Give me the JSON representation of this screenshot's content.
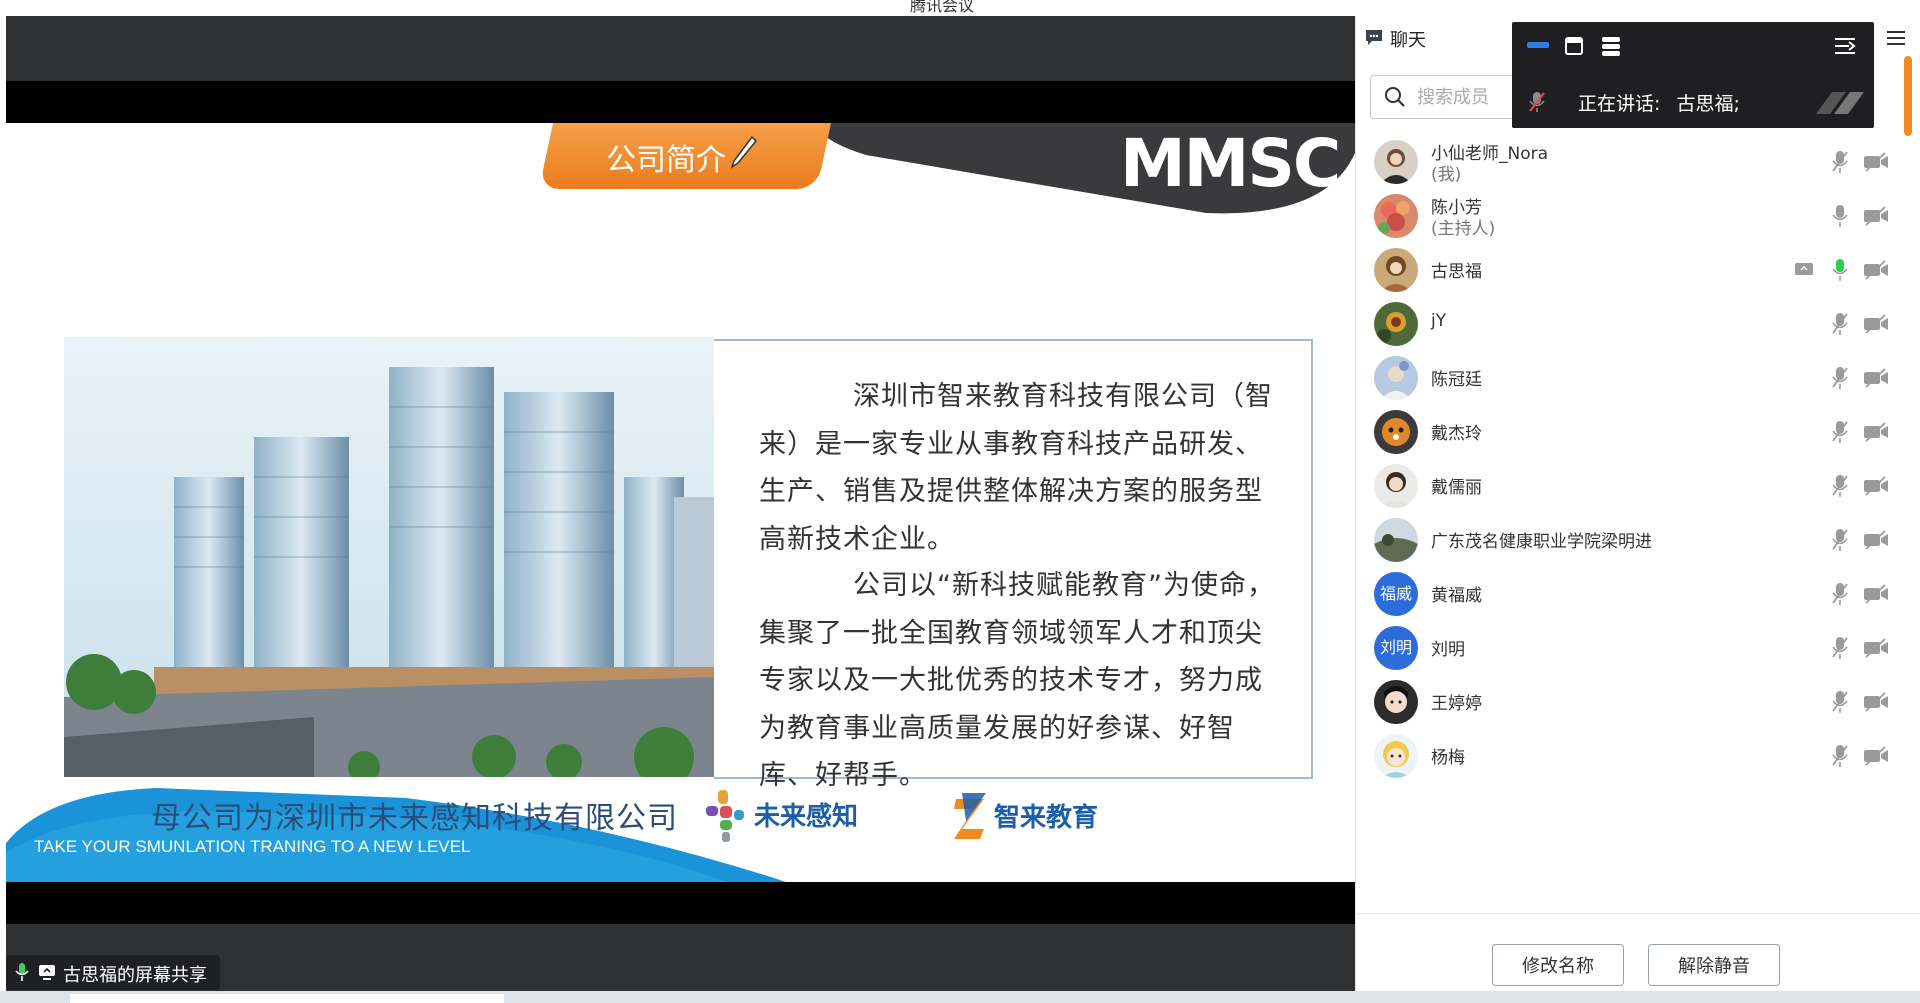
{
  "window": {
    "title": "腾讯会议"
  },
  "share": {
    "label": "古思福的屏幕共享"
  },
  "slide": {
    "tag": "公司简介",
    "brand": "MMSC",
    "para1": "深圳市智来教育科技有限公司（智来）是一家专业从事教育科技产品研发、生产、销售及提供整体解决方案的服务型高新技术企业。",
    "para2": "公司以“新科技赋能教育”为使命，集聚了一批全国教育领域领军人才和顶尖专家以及一大批优秀的技术专才，努力成为教育事业高质量发展的好参谋、好智库、好帮手。",
    "parent_company": "母公司为深圳市未来感知科技有限公司",
    "tagline": "TAKE YOUR SMUNLATION TRANING TO A NEW LEVEL",
    "logo1_name": "未来感知",
    "logo2_name": "智来教育"
  },
  "panel": {
    "chat_tab": "聊天",
    "search_placeholder": "搜索成员",
    "speaking_label": "正在讲话:",
    "speaking_name": "古思福;",
    "members": [
      {
        "name": "小仙老师_Nora",
        "role": "(我)",
        "mic": "muted",
        "avatar_text": ""
      },
      {
        "name": "陈小芳",
        "role": "(主持人)",
        "mic": "off",
        "avatar_text": ""
      },
      {
        "name": "古思福",
        "role": "",
        "mic": "speaking",
        "sharing": true,
        "avatar_text": ""
      },
      {
        "name": "jY",
        "role": "",
        "mic": "muted",
        "avatar_text": ""
      },
      {
        "name": "陈冠廷",
        "role": "",
        "mic": "muted",
        "avatar_text": ""
      },
      {
        "name": "戴杰玲",
        "role": "",
        "mic": "muted",
        "avatar_text": ""
      },
      {
        "name": "戴儒丽",
        "role": "",
        "mic": "muted",
        "avatar_text": ""
      },
      {
        "name": "广东茂名健康职业学院梁明进",
        "role": "",
        "mic": "muted",
        "avatar_text": ""
      },
      {
        "name": "黄福威",
        "role": "",
        "mic": "muted",
        "avatar_text": "福威"
      },
      {
        "name": "刘明",
        "role": "",
        "mic": "muted",
        "avatar_text": "刘明"
      },
      {
        "name": "王婷婷",
        "role": "",
        "mic": "muted",
        "avatar_text": ""
      },
      {
        "name": "杨梅",
        "role": "",
        "mic": "muted",
        "avatar_text": ""
      }
    ],
    "rename_button": "修改名称",
    "unmute_button": "解除静音"
  }
}
